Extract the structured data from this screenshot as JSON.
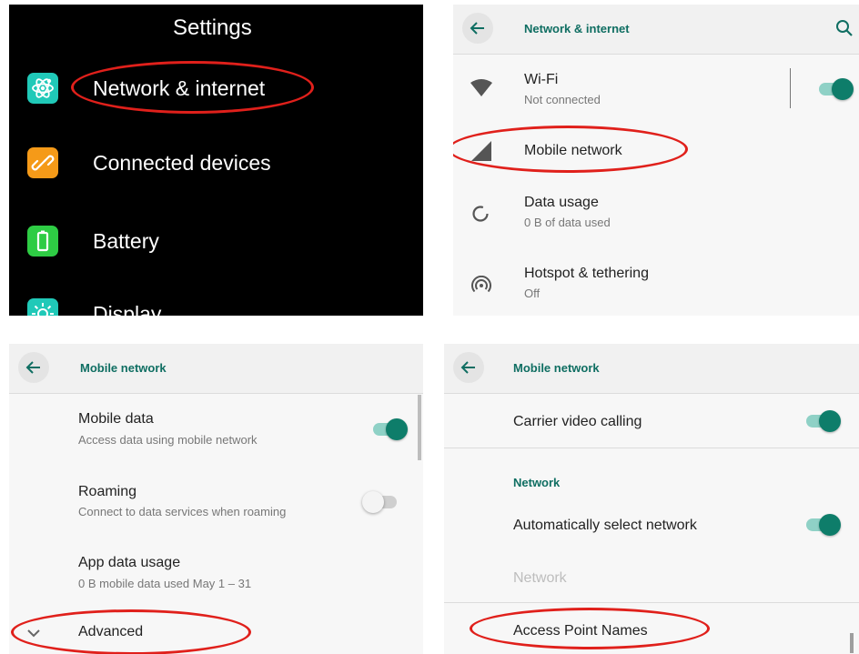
{
  "panel1": {
    "title": "Settings",
    "items": [
      {
        "label": "Network & internet",
        "icon": "network-icon",
        "color": "#20c9b8"
      },
      {
        "label": "Connected devices",
        "icon": "connected-devices-icon",
        "color": "#f59a18"
      },
      {
        "label": "Battery",
        "icon": "battery-icon",
        "color": "#2ecc44"
      },
      {
        "label": "Display",
        "icon": "display-icon",
        "color": "#20c9b8"
      }
    ]
  },
  "panel2": {
    "title": "Network & internet",
    "rows": [
      {
        "title": "Wi-Fi",
        "subtitle": "Not connected",
        "icon": "wifi-icon",
        "toggle": true
      },
      {
        "title": "Mobile network",
        "icon": "mobile-signal-icon"
      },
      {
        "title": "Data usage",
        "subtitle": "0 B of data used",
        "icon": "data-usage-icon"
      },
      {
        "title": "Hotspot & tethering",
        "subtitle": "Off",
        "icon": "hotspot-icon"
      }
    ]
  },
  "panel3": {
    "title": "Mobile network",
    "rows": [
      {
        "title": "Mobile data",
        "subtitle": "Access data using mobile network",
        "toggle": true
      },
      {
        "title": "Roaming",
        "subtitle": "Connect to data services when roaming",
        "toggle": false
      },
      {
        "title": "App data usage",
        "subtitle": "0 B mobile data used May 1 – 31"
      },
      {
        "title": "Advanced",
        "icon": "chevron-down-icon"
      }
    ]
  },
  "panel4": {
    "title": "Mobile network",
    "rows": [
      {
        "title": "Carrier video calling",
        "toggle": true
      },
      {
        "section": "Network"
      },
      {
        "title": "Automatically select network",
        "toggle": true
      },
      {
        "title": "Network",
        "disabled": true
      },
      {
        "title": "Access Point Names"
      }
    ]
  },
  "colors": {
    "accent": "#0e7d6a",
    "highlight": "#e0201b",
    "teal_icon": "#20c9b8",
    "orange_icon": "#f59a18",
    "green_icon": "#2ecc44"
  }
}
